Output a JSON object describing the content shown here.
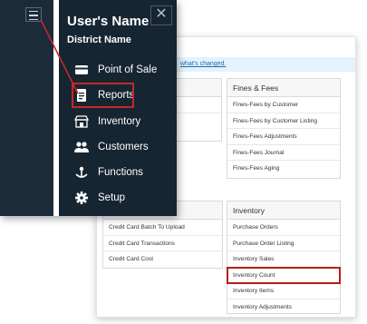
{
  "drawer": {
    "user_name": "User's Name",
    "district_name": "District Name",
    "items": [
      {
        "label": "Point of Sale",
        "icon": "card-icon"
      },
      {
        "label": "Reports",
        "icon": "report-icon"
      },
      {
        "label": "Inventory",
        "icon": "store-icon"
      },
      {
        "label": "Customers",
        "icon": "people-icon"
      },
      {
        "label": "Functions",
        "icon": "functions-icon"
      },
      {
        "label": "Setup",
        "icon": "gear-icon"
      }
    ]
  },
  "page": {
    "banner_link": "what's changed."
  },
  "fines_card": {
    "title": "Fines & Fees",
    "items": [
      "Fines-Fees by Customer",
      "Fines-Fees by Customer Listing",
      "Fines-Fees Adjustments",
      "Fines-Fees Journal",
      "Fines-Fees Aging"
    ]
  },
  "cc_card": {
    "items": [
      "Credit Card Batch To Upload",
      "Credit Card Transactions",
      "Credit Card Cost"
    ]
  },
  "inventory_card": {
    "title": "Inventory",
    "items": [
      "Purchase Orders",
      "Purchase Order Listing",
      "Inventory Sales",
      "Inventory Count",
      "Inventory Items",
      "Inventory Adjustments"
    ]
  },
  "colors": {
    "drawer_bg": "#162532",
    "highlight": "#c62828",
    "link": "#1a6fb5"
  }
}
